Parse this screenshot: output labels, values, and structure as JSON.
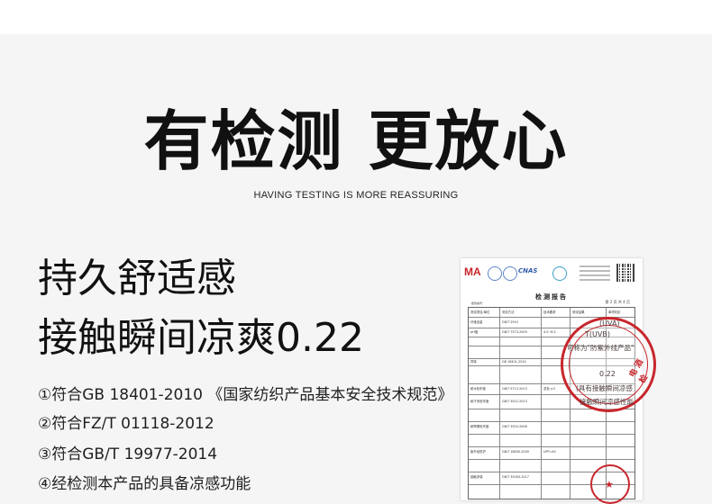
{
  "headline": "有检测 更放心",
  "subheadline": "HAVING TESTING IS MORE REASSURING",
  "feature_line_1": "持久舒适感",
  "feature_line_2": "接触瞬间凉爽0.22",
  "standards": [
    "①符合GB 18401-2010 《国家纺织产品基本安全技术规范》",
    "②符合FZ/T 01118-2012",
    "③符合GB/T 19977-2014",
    "④经检测本产品的具备凉感功能"
  ],
  "report": {
    "logo_ma": "MA",
    "logo_cnas": "CNAS",
    "title": "检测报告",
    "page": "第 2 页 共 4 页",
    "report_no": "报告编号：",
    "cells": [
      "测试项目/单位",
      "测试方法",
      "技术要求",
      "测试结果",
      "单项判定",
      "纤维含量",
      "GB/T 2910",
      "pH值",
      "GB/T 7573-2009",
      "4.0~8.5",
      "异味",
      "GB 18401-2010",
      "耐水色牢度",
      "GB/T 5713-2013",
      "变色 ≥3",
      "耐汗渍色牢度",
      "GB/T 3922-2013",
      "耐摩擦色牢度",
      "GB/T 3920-2008",
      "紫外线防护",
      "GB/T 18830-2009",
      "接触凉感",
      "GB/T 35263-2017",
      "UPF>40"
    ]
  },
  "stamp": {
    "line1": "(UVA)",
    "line2": "T(UVB)",
    "line3": "可称为\"防紫外线产品\"",
    "value": "0.22",
    "line5": "(具有接触瞬间凉感",
    "line6": "接触瞬间凉感性能",
    "red_text": "电 酒 检"
  }
}
